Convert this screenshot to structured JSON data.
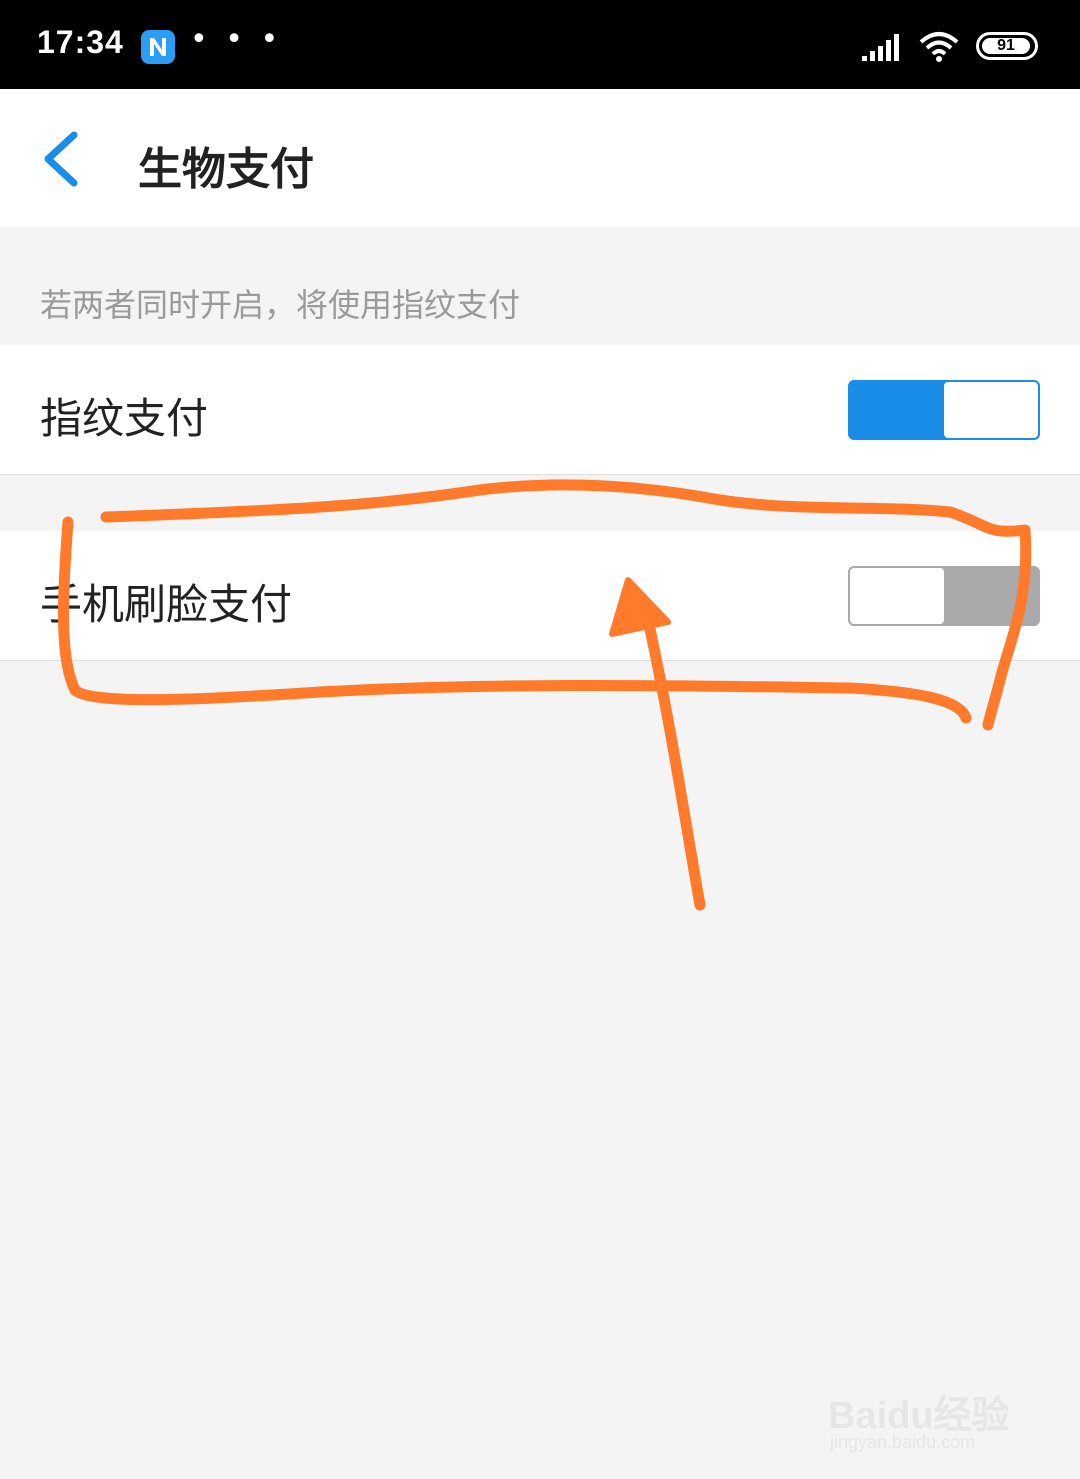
{
  "status_bar": {
    "time": "17:34",
    "app_icon": "n-app-icon",
    "more_indicator": "• • •",
    "signal_icon": "signal-icon",
    "wifi_icon": "wifi-icon",
    "battery_level": "91"
  },
  "header": {
    "back_icon": "chevron-left-icon",
    "title": "生物支付"
  },
  "hint": "若两者同时开启，将使用指纹支付",
  "settings": [
    {
      "label": "指纹支付",
      "enabled": true
    },
    {
      "label": "手机刷脸支付",
      "enabled": false
    }
  ],
  "colors": {
    "accent": "#1a8de8",
    "toggle_off": "#a9aaa9",
    "annotation": "#ff7a2a",
    "background": "#f4f4f4"
  },
  "watermark": {
    "logo": "Baidu经验",
    "url": "jingyan.baidu.com"
  }
}
